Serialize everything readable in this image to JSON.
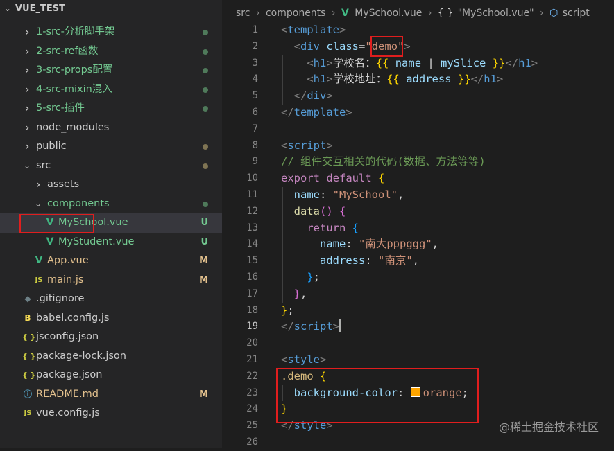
{
  "explorer": {
    "project": "VUE_TEST",
    "items": [
      {
        "label": "1-src-分析脚手架",
        "kind": "folder",
        "level": 1,
        "open": false,
        "color": "#73c991",
        "status": "dot",
        "dot_color": "#4f7a5a"
      },
      {
        "label": "2-src-ref函数",
        "kind": "folder",
        "level": 1,
        "open": false,
        "color": "#73c991",
        "status": "dot",
        "dot_color": "#4f7a5a"
      },
      {
        "label": "3-src-props配置",
        "kind": "folder",
        "level": 1,
        "open": false,
        "color": "#73c991",
        "status": "dot",
        "dot_color": "#4f7a5a"
      },
      {
        "label": "4-src-mixin混入",
        "kind": "folder",
        "level": 1,
        "open": false,
        "color": "#73c991",
        "status": "dot",
        "dot_color": "#4f7a5a"
      },
      {
        "label": "5-src-插件",
        "kind": "folder",
        "level": 1,
        "open": false,
        "color": "#73c991",
        "status": "dot",
        "dot_color": "#4f7a5a"
      },
      {
        "label": "node_modules",
        "kind": "folder",
        "level": 1,
        "open": false,
        "color": "#cccccc",
        "status": ""
      },
      {
        "label": "public",
        "kind": "folder",
        "level": 1,
        "open": false,
        "color": "#cccccc",
        "status": "dot",
        "dot_color": "#7f7453"
      },
      {
        "label": "src",
        "kind": "folder",
        "level": 1,
        "open": true,
        "color": "#cccccc",
        "status": "dot",
        "dot_color": "#7f7453"
      },
      {
        "label": "assets",
        "kind": "folder",
        "level": 2,
        "open": false,
        "color": "#cccccc",
        "status": ""
      },
      {
        "label": "components",
        "kind": "folder",
        "level": 2,
        "open": true,
        "color": "#73c991",
        "status": "dot",
        "dot_color": "#4f7a5a"
      },
      {
        "label": "MySchool.vue",
        "kind": "vue",
        "level": 3,
        "color": "#73c991",
        "status": "badge",
        "badge": "U",
        "badge_color": "#73c991",
        "selected": true
      },
      {
        "label": "MyStudent.vue",
        "kind": "vue",
        "level": 3,
        "color": "#73c991",
        "status": "badge",
        "badge": "U",
        "badge_color": "#73c991"
      },
      {
        "label": "App.vue",
        "kind": "vue",
        "level": 2,
        "color": "#e2c08d",
        "status": "badge",
        "badge": "M",
        "badge_color": "#e2c08d"
      },
      {
        "label": "main.js",
        "kind": "js",
        "level": 2,
        "color": "#e2c08d",
        "status": "badge",
        "badge": "M",
        "badge_color": "#e2c08d"
      },
      {
        "label": ".gitignore",
        "kind": "git",
        "level": 1,
        "color": "#cccccc",
        "status": ""
      },
      {
        "label": "babel.config.js",
        "kind": "babel",
        "level": 1,
        "color": "#cccccc",
        "status": ""
      },
      {
        "label": "jsconfig.json",
        "kind": "json",
        "level": 1,
        "color": "#cccccc",
        "status": ""
      },
      {
        "label": "package-lock.json",
        "kind": "json",
        "level": 1,
        "color": "#cccccc",
        "status": ""
      },
      {
        "label": "package.json",
        "kind": "json",
        "level": 1,
        "color": "#cccccc",
        "status": ""
      },
      {
        "label": "README.md",
        "kind": "info",
        "level": 1,
        "color": "#e2c08d",
        "status": "badge",
        "badge": "M",
        "badge_color": "#e2c08d"
      },
      {
        "label": "vue.config.js",
        "kind": "js",
        "level": 1,
        "color": "#cccccc",
        "status": ""
      }
    ]
  },
  "icons": {
    "chevron-right": "›",
    "chevron-down": "⌄",
    "vue": "V",
    "js": "JS",
    "git": "◆",
    "babel": "B",
    "json": "{ }",
    "info": "ⓘ"
  },
  "breadcrumb": {
    "parts": [
      "src",
      "components",
      "MySchool.vue",
      "\"MySchool.vue\"",
      "script"
    ],
    "vue_icon": "V",
    "brace_icon": "{ }",
    "cube_icon": "⬡"
  },
  "editor": {
    "active_line": 19,
    "lines": [
      [
        [
          "t-tag",
          "<"
        ],
        [
          "t-tn",
          "template"
        ],
        [
          "t-tag",
          ">"
        ]
      ],
      [
        [
          "t-txt",
          "  "
        ],
        [
          "t-tag",
          "<"
        ],
        [
          "t-tn",
          "div"
        ],
        [
          "t-txt",
          " "
        ],
        [
          "t-attr",
          "class"
        ],
        [
          "t-txt",
          "="
        ],
        [
          "t-str",
          "\"demo\""
        ],
        [
          "t-tag",
          ">"
        ]
      ],
      [
        [
          "t-txt",
          "    "
        ],
        [
          "t-tag",
          "<"
        ],
        [
          "t-tn",
          "h1"
        ],
        [
          "t-tag",
          ">"
        ],
        [
          "t-txt",
          "学校名："
        ],
        [
          "t-brace",
          "{{"
        ],
        [
          "t-txt",
          " "
        ],
        [
          "t-prop",
          "name"
        ],
        [
          "t-txt",
          " | "
        ],
        [
          "t-prop",
          "mySlice"
        ],
        [
          "t-txt",
          " "
        ],
        [
          "t-brace",
          "}}"
        ],
        [
          "t-tag",
          "</"
        ],
        [
          "t-tn",
          "h1"
        ],
        [
          "t-tag",
          ">"
        ]
      ],
      [
        [
          "t-txt",
          "    "
        ],
        [
          "t-tag",
          "<"
        ],
        [
          "t-tn",
          "h1"
        ],
        [
          "t-tag",
          ">"
        ],
        [
          "t-txt",
          "学校地址："
        ],
        [
          "t-brace",
          "{{"
        ],
        [
          "t-txt",
          " "
        ],
        [
          "t-prop",
          "address"
        ],
        [
          "t-txt",
          " "
        ],
        [
          "t-brace",
          "}}"
        ],
        [
          "t-tag",
          "</"
        ],
        [
          "t-tn",
          "h1"
        ],
        [
          "t-tag",
          ">"
        ]
      ],
      [
        [
          "t-txt",
          "  "
        ],
        [
          "t-tag",
          "</"
        ],
        [
          "t-tn",
          "div"
        ],
        [
          "t-tag",
          ">"
        ]
      ],
      [
        [
          "t-tag",
          "</"
        ],
        [
          "t-tn",
          "template"
        ],
        [
          "t-tag",
          ">"
        ]
      ],
      [],
      [
        [
          "t-tag",
          "<"
        ],
        [
          "t-tn",
          "script"
        ],
        [
          "t-tag",
          ">"
        ]
      ],
      [
        [
          "t-cmt",
          "// 组件交互相关的代码(数据、方法等等)"
        ]
      ],
      [
        [
          "t-kw",
          "export"
        ],
        [
          "t-txt",
          " "
        ],
        [
          "t-kw",
          "default"
        ],
        [
          "t-txt",
          " "
        ],
        [
          "t-brace",
          "{"
        ]
      ],
      [
        [
          "t-txt",
          "  "
        ],
        [
          "t-prop",
          "name"
        ],
        [
          "t-txt",
          ": "
        ],
        [
          "t-str",
          "\"MySchool\""
        ],
        [
          "t-txt",
          ","
        ]
      ],
      [
        [
          "t-txt",
          "  "
        ],
        [
          "t-fn",
          "data"
        ],
        [
          "t-brace2",
          "()"
        ],
        [
          "t-txt",
          " "
        ],
        [
          "t-brace2",
          "{"
        ]
      ],
      [
        [
          "t-txt",
          "    "
        ],
        [
          "t-kw",
          "return"
        ],
        [
          "t-txt",
          " "
        ],
        [
          "t-brace3",
          "{"
        ]
      ],
      [
        [
          "t-txt",
          "      "
        ],
        [
          "t-prop",
          "name"
        ],
        [
          "t-txt",
          ": "
        ],
        [
          "t-str",
          "\"南大pppggg\""
        ],
        [
          "t-txt",
          ","
        ]
      ],
      [
        [
          "t-txt",
          "      "
        ],
        [
          "t-prop",
          "address"
        ],
        [
          "t-txt",
          ": "
        ],
        [
          "t-str",
          "\"南京\""
        ],
        [
          "t-txt",
          ","
        ]
      ],
      [
        [
          "t-txt",
          "    "
        ],
        [
          "t-brace3",
          "}"
        ],
        [
          "t-txt",
          ";"
        ]
      ],
      [
        [
          "t-txt",
          "  "
        ],
        [
          "t-brace2",
          "}"
        ],
        [
          "t-txt",
          ","
        ]
      ],
      [
        [
          "t-brace",
          "}"
        ],
        [
          "t-txt",
          ";"
        ]
      ],
      [
        [
          "t-tag",
          "</"
        ],
        [
          "t-tn",
          "script"
        ],
        [
          "t-tag",
          ">"
        ],
        [
          "cursor",
          ""
        ]
      ],
      [],
      [
        [
          "t-tag",
          "<"
        ],
        [
          "t-tn",
          "style"
        ],
        [
          "t-tag",
          ">"
        ]
      ],
      [
        [
          "t-sel",
          ".demo"
        ],
        [
          "t-txt",
          " "
        ],
        [
          "t-brace",
          "{"
        ]
      ],
      [
        [
          "t-txt",
          "  "
        ],
        [
          "t-prop",
          "background-color"
        ],
        [
          "t-txt",
          ": "
        ],
        [
          "swatch",
          ""
        ],
        [
          "t-str",
          "orange"
        ],
        [
          "t-txt",
          ";"
        ]
      ],
      [
        [
          "t-brace",
          "}"
        ]
      ],
      [
        [
          "t-tag",
          "</"
        ],
        [
          "t-tn",
          "style"
        ],
        [
          "t-tag",
          ">"
        ]
      ],
      []
    ]
  },
  "watermark": "@稀土掘金技术社区"
}
